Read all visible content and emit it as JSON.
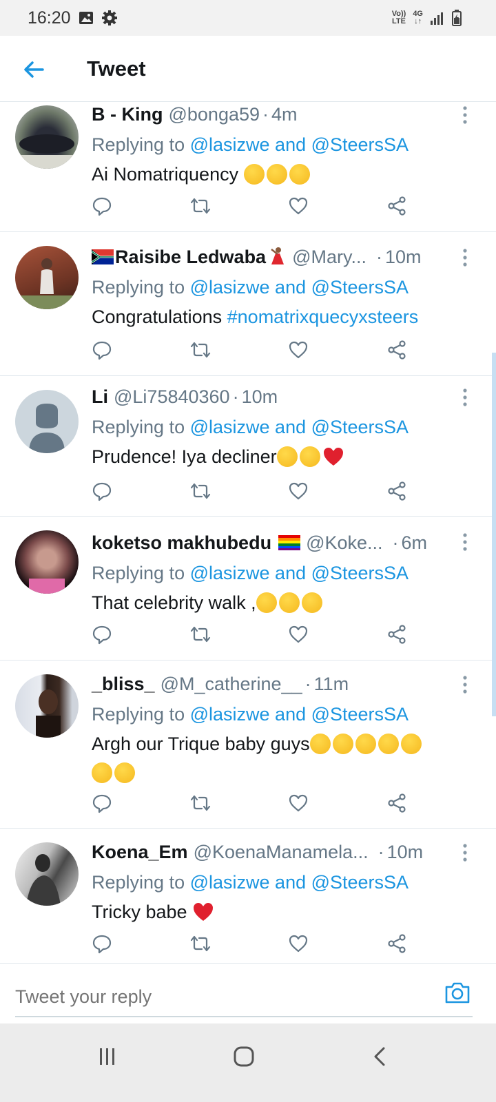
{
  "status": {
    "time": "16:20",
    "network_top": "Vo))",
    "network_bottom": "LTE",
    "data_top": "4G"
  },
  "header": {
    "title": "Tweet",
    "back_icon": "back-arrow-icon"
  },
  "reply_prefix": "Replying to",
  "reply_links": "@lasizwe and @SteersSA",
  "tweets": [
    {
      "name": "B - King",
      "handle": "@bonga59",
      "time": "4m",
      "text": "Ai Nomatriquency"
    },
    {
      "name": "Raisibe Ledwaba",
      "handle": "@Mary...",
      "time": "10m",
      "text": "Congratulations",
      "hashtag": "#nomatrixquecyxsteers"
    },
    {
      "name": "Li",
      "handle": "@Li75840360",
      "time": "10m",
      "text": "Prudence! Iya decliner"
    },
    {
      "name": "koketso makhubedu",
      "handle": "@Koke...",
      "time": "6m",
      "text": "That celebrity walk ,"
    },
    {
      "name": "_bliss_",
      "handle": "@M_catherine__",
      "time": "11m",
      "text": "Argh our Trique baby guys"
    },
    {
      "name": "Koena_Em",
      "handle": "@KoenaManamela...",
      "time": "10m",
      "text": "Tricky babe"
    }
  ],
  "composer": {
    "placeholder": "Tweet your reply"
  },
  "colors": {
    "link": "#1b95e0",
    "secondary": "#657786",
    "primary_text": "#14171a"
  }
}
